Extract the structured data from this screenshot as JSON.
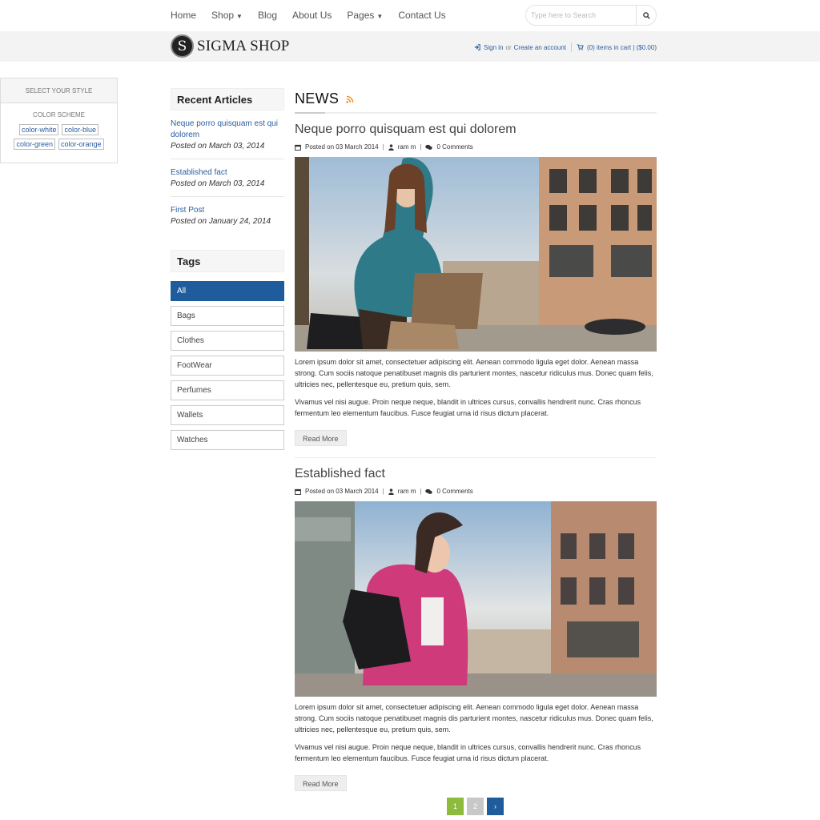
{
  "nav": {
    "items": [
      {
        "label": "Home",
        "caret": false
      },
      {
        "label": "Shop",
        "caret": true
      },
      {
        "label": "Blog",
        "caret": false
      },
      {
        "label": "About Us",
        "caret": false
      },
      {
        "label": "Pages",
        "caret": true
      },
      {
        "label": "Contact Us",
        "caret": false
      }
    ],
    "search_placeholder": "Type here to Search"
  },
  "header": {
    "logo_letter": "S",
    "brand": "SIGMA SHOP",
    "sign_in": "Sign in",
    "or": "or",
    "create_account": "Create an account",
    "cart": "(0) items in cart | ($0.00)"
  },
  "style_switcher": {
    "title": "SELECT YOUR STYLE",
    "subtitle": "COLOR SCHEME",
    "swatches": [
      "color-white",
      "color-blue",
      "color-green",
      "color-orange"
    ]
  },
  "sidebar": {
    "recent_title": "Recent Articles",
    "articles": [
      {
        "title": "Neque porro quisquam est qui dolorem",
        "date": "Posted on March 03, 2014"
      },
      {
        "title": "Established fact",
        "date": "Posted on March 03, 2014"
      },
      {
        "title": "First Post",
        "date": "Posted on January 24, 2014"
      }
    ],
    "tags_title": "Tags",
    "tags": [
      "All",
      "Bags",
      "Clothes",
      "FootWear",
      "Perfumes",
      "Wallets",
      "Watches"
    ]
  },
  "main": {
    "heading": "NEWS",
    "posts": [
      {
        "title": "Neque porro quisquam est qui dolorem",
        "posted": "Posted on 03 March 2014",
        "author": "ram m",
        "comments": "0 Comments",
        "p1": "Lorem ipsum dolor sit amet, consectetuer adipiscing elit. Aenean commodo ligula eget dolor. Aenean massa strong. Cum sociis natoque penatibuset magnis dis parturient montes, nascetur ridiculus mus. Donec quam felis, ultricies nec, pellentesque eu, pretium quis, sem.",
        "p2": "Vivamus vel nisi augue. Proin neque neque, blandit in ultrices cursus, convallis hendrerit nunc. Cras rhoncus fermentum leo elementum faucibus. Fusce feugiat urna id risus dictum placerat.",
        "read_more": "Read More"
      },
      {
        "title": "Established fact",
        "posted": "Posted on 03 March 2014",
        "author": "ram m",
        "comments": "0 Comments",
        "p1": "Lorem ipsum dolor sit amet, consectetuer adipiscing elit. Aenean commodo ligula eget dolor. Aenean massa strong. Cum sociis natoque penatibuset magnis dis parturient montes, nascetur ridiculus mus. Donec quam felis, ultricies nec, pellentesque eu, pretium quis, sem.",
        "p2": "Vivamus vel nisi augue. Proin neque neque, blandit in ultrices cursus, convallis hendrerit nunc. Cras rhoncus fermentum leo elementum faucibus. Fusce feugiat urna id risus dictum placerat.",
        "read_more": "Read More"
      }
    ]
  },
  "pagination": {
    "pages": [
      "1",
      "2"
    ],
    "next": "›",
    "colors": {
      "current": "#8dbb3c",
      "other": "#c8c8c8",
      "next": "#1f5c9c"
    }
  },
  "colors": {
    "accent": "#1f5c9c",
    "link": "#2a5d9f",
    "rss": "#f08a24"
  }
}
